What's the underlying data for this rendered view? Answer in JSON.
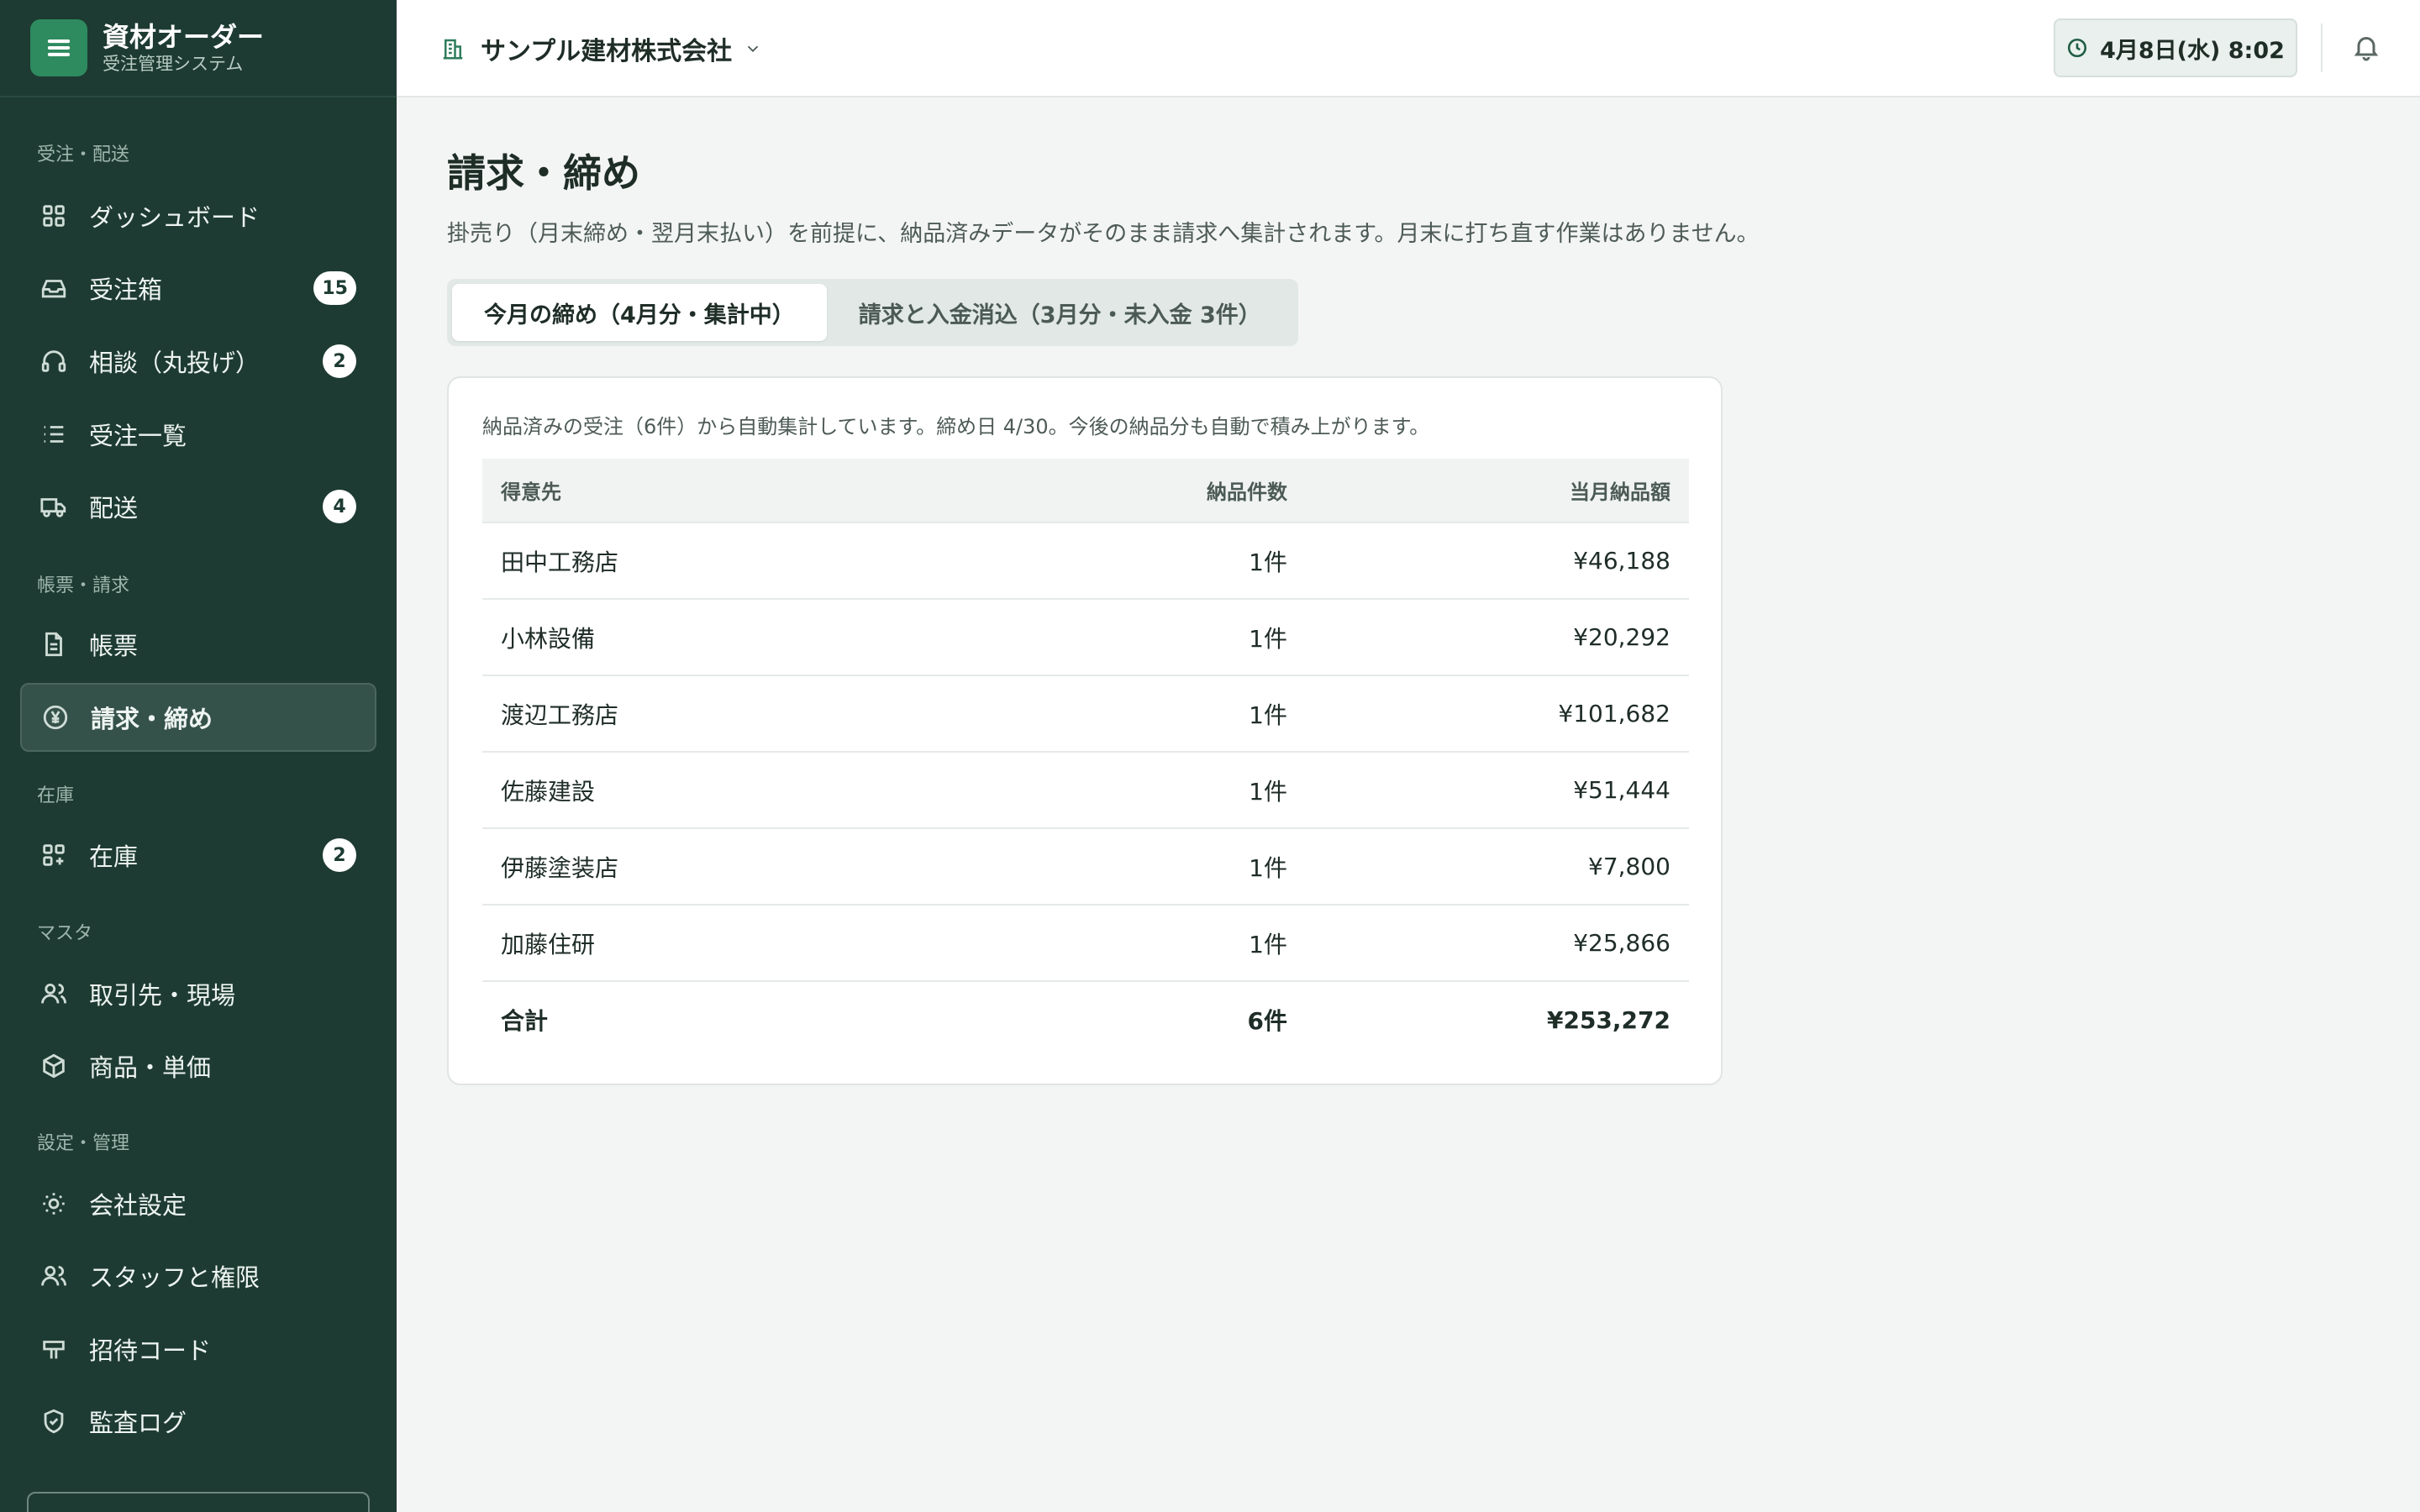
{
  "brand": {
    "title": "資材オーダー",
    "subtitle": "受注管理システム"
  },
  "sidebar": {
    "sections": [
      {
        "label": "受注・配送"
      },
      {
        "label": "帳票・請求"
      },
      {
        "label": "在庫"
      },
      {
        "label": "マスタ"
      },
      {
        "label": "設定・管理"
      }
    ],
    "items": [
      {
        "label": "ダッシュボード",
        "icon": "grid-icon"
      },
      {
        "label": "受注箱",
        "icon": "inbox-icon",
        "badge": "15"
      },
      {
        "label": "相談（丸投げ）",
        "icon": "headset-icon",
        "badge": "2"
      },
      {
        "label": "受注一覧",
        "icon": "list-icon"
      },
      {
        "label": "配送",
        "icon": "truck-icon",
        "badge": "4"
      },
      {
        "label": "帳票",
        "icon": "document-icon"
      },
      {
        "label": "請求・締め",
        "icon": "yen-icon",
        "active": true
      },
      {
        "label": "在庫",
        "icon": "grid-plus-icon",
        "badge": "2"
      },
      {
        "label": "取引先・現場",
        "icon": "users-icon"
      },
      {
        "label": "商品・単価",
        "icon": "box-icon"
      },
      {
        "label": "会社設定",
        "icon": "sun-gear-icon"
      },
      {
        "label": "スタッフと権限",
        "icon": "users-icon"
      },
      {
        "label": "招待コード",
        "icon": "signpost-icon"
      },
      {
        "label": "監査ログ",
        "icon": "shield-check-icon"
      }
    ]
  },
  "header": {
    "company": "サンプル建材株式会社",
    "datetime": "4月8日(水) 8:02"
  },
  "main": {
    "title": "請求・締め",
    "description": "掛売り（月末締め・翌月末払い）を前提に、納品済みデータがそのまま請求へ集計されます。月末に打ち直す作業はありません。",
    "tabs": [
      {
        "label": "今月の締め（4月分・集計中）",
        "active": true
      },
      {
        "label": "請求と入金消込（3月分・未入金 3件）",
        "active": false
      }
    ],
    "note": "納品済みの受注（6件）から自動集計しています。締め日 4/30。今後の納品分も自動で積み上がります。",
    "table": {
      "headers": [
        "得意先",
        "納品件数",
        "当月納品額"
      ],
      "rows": [
        [
          "田中工務店",
          "1件",
          "¥46,188"
        ],
        [
          "小林設備",
          "1件",
          "¥20,292"
        ],
        [
          "渡辺工務店",
          "1件",
          "¥101,682"
        ],
        [
          "佐藤建設",
          "1件",
          "¥51,444"
        ],
        [
          "伊藤塗装店",
          "1件",
          "¥7,800"
        ],
        [
          "加藤住研",
          "1件",
          "¥25,866"
        ]
      ],
      "total": [
        "合計",
        "6件",
        "¥253,272"
      ]
    }
  },
  "colors": {
    "sidebar_bg": "#1d3b32",
    "brand_accent": "#2e8a5f",
    "page_bg": "#f3f5f4"
  }
}
